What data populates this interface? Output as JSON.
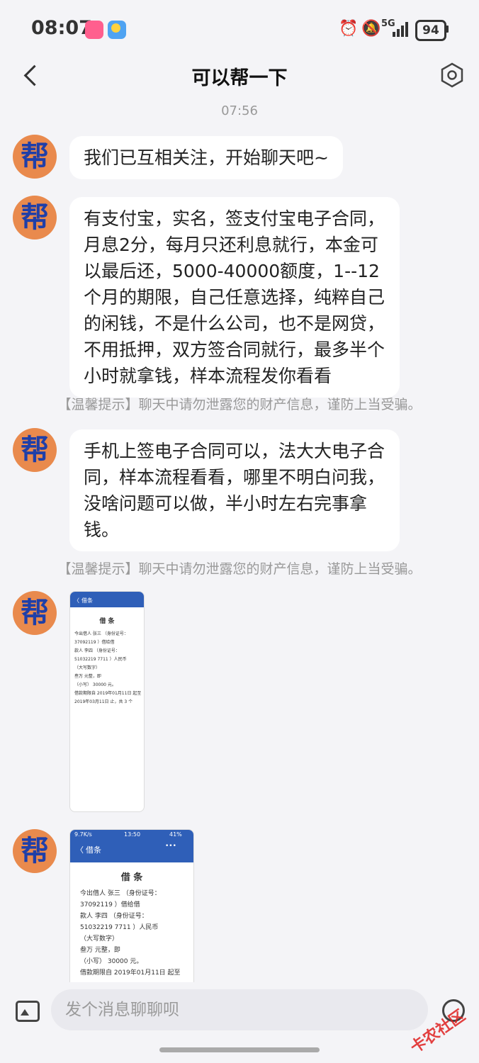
{
  "status_bar": {
    "time": "08:07",
    "network": "5G",
    "battery": "94"
  },
  "header": {
    "title": "可以帮一下"
  },
  "chat": {
    "timestamp": "07:56",
    "avatar_char": "帮",
    "messages": [
      {
        "type": "text",
        "text": "我们已互相关注，开始聊天吧~"
      },
      {
        "type": "text",
        "text": "有支付宝，实名，签支付宝电子合同，\n月息2分，每月只还利息就行，本金可\n以最后还，5000-40000额度，1--12\n个月的期限，自己任意选择，纯粹自己\n的闲钱，不是什么公司，也不是网贷，\n不用抵押，双方签合同就行，最多半个\n小时就拿钱，样本流程发你看看"
      },
      {
        "type": "tip",
        "text": "【温馨提示】聊天中请勿泄露您的财产信息，谨防上当受骗。"
      },
      {
        "type": "text",
        "text": "手机上签电子合同可以，法大大电子合\n同，样本流程看看，哪里不明白问我，\n没啥问题可以做，半小时左右完事拿\n钱。"
      },
      {
        "type": "tip",
        "text": "【温馨提示】聊天中请勿泄露您的财产信息，谨防上当受骗。"
      },
      {
        "type": "image",
        "caption": "借条 screenshot"
      },
      {
        "type": "image",
        "caption": "借条 screenshot large"
      }
    ]
  },
  "image_doc": {
    "nav_back": "〈",
    "nav_title": "借条",
    "nav_more": "•••",
    "status_time": "13:50",
    "status_left": "9.7K/s",
    "status_right": "41%",
    "heading": "借 条",
    "lines": [
      "今出借人 张三  （身份证号：",
      "37092119    ）借给借",
      "款人 李四    （身份证号：",
      "51032219    7711 ）人民币",
      "（大写数字）",
      "叁万              元整，即",
      "（小写） 30000     元。",
      "借款期限自 2019年01月11日  起至",
      "2019年03月11日  止，共 3      个"
    ]
  },
  "composer": {
    "placeholder": "发个消息聊聊呗"
  },
  "watermark": "卡农社区"
}
